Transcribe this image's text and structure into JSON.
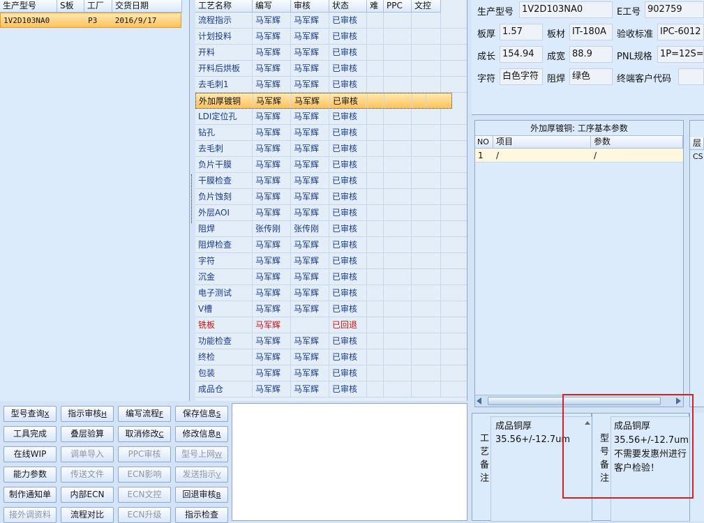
{
  "orders": {
    "headers": [
      "生产型号",
      "S板",
      "工厂",
      "交货日期"
    ],
    "rows": [
      {
        "model": "1V2D103NA0",
        "sboard": "",
        "factory": "P3",
        "date": "2016/9/17"
      }
    ]
  },
  "process": {
    "headers": [
      "工艺名称",
      "编写",
      "审核",
      "状态",
      "难",
      "PPC",
      "文控"
    ],
    "rows": [
      {
        "name": "流程指示",
        "writer": "马军辉",
        "reviewer": "马军辉",
        "status": "已审核"
      },
      {
        "name": "计划投料",
        "writer": "马军辉",
        "reviewer": "马军辉",
        "status": "已审核"
      },
      {
        "name": "开料",
        "writer": "马军辉",
        "reviewer": "马军辉",
        "status": "已审核"
      },
      {
        "name": "开料后烘板",
        "writer": "马军辉",
        "reviewer": "马军辉",
        "status": "已审核"
      },
      {
        "name": "去毛刺1",
        "writer": "马军辉",
        "reviewer": "马军辉",
        "status": "已审核"
      },
      {
        "name": "外加厚镀铜",
        "writer": "马军辉",
        "reviewer": "马军辉",
        "status": "已审核"
      },
      {
        "name": "LDI定位孔",
        "writer": "马军辉",
        "reviewer": "马军辉",
        "status": "已审核"
      },
      {
        "name": "钻孔",
        "writer": "马军辉",
        "reviewer": "马军辉",
        "status": "已审核"
      },
      {
        "name": "去毛刺",
        "writer": "马军辉",
        "reviewer": "马军辉",
        "status": "已审核"
      },
      {
        "name": "负片干膜",
        "writer": "马军辉",
        "reviewer": "马军辉",
        "status": "已审核"
      },
      {
        "name": "干膜检查",
        "writer": "马军辉",
        "reviewer": "马军辉",
        "status": "已审核"
      },
      {
        "name": "负片蚀刻",
        "writer": "马军辉",
        "reviewer": "马军辉",
        "status": "已审核"
      },
      {
        "name": "外层AOI",
        "writer": "马军辉",
        "reviewer": "马军辉",
        "status": "已审核"
      },
      {
        "name": "阻焊",
        "writer": "张传刚",
        "reviewer": "张传刚",
        "status": "已审核"
      },
      {
        "name": "阻焊检查",
        "writer": "马军辉",
        "reviewer": "马军辉",
        "status": "已审核"
      },
      {
        "name": "字符",
        "writer": "马军辉",
        "reviewer": "马军辉",
        "status": "已审核"
      },
      {
        "name": "沉金",
        "writer": "马军辉",
        "reviewer": "马军辉",
        "status": "已审核"
      },
      {
        "name": "电子测试",
        "writer": "马军辉",
        "reviewer": "马军辉",
        "status": "已审核"
      },
      {
        "name": "V槽",
        "writer": "马军辉",
        "reviewer": "马军辉",
        "status": "已审核"
      },
      {
        "name": "铣板",
        "writer": "马军辉",
        "reviewer": "",
        "status": "已回退"
      },
      {
        "name": "功能检查",
        "writer": "马军辉",
        "reviewer": "马军辉",
        "status": "已审核"
      },
      {
        "name": "终检",
        "writer": "马军辉",
        "reviewer": "马军辉",
        "status": "已审核"
      },
      {
        "name": "包装",
        "writer": "马军辉",
        "reviewer": "马军辉",
        "status": "已审核"
      },
      {
        "name": "成品仓",
        "writer": "马军辉",
        "reviewer": "马军辉",
        "status": "已审核"
      }
    ]
  },
  "info": {
    "model_label": "生产型号",
    "model_value": "1V2D103NA0",
    "eno_label": "E工号",
    "eno_value": "902759",
    "thickness_label": "板厚",
    "thickness_value": "1.57",
    "material_label": "板材",
    "material_value": "IT-180A",
    "standard_label": "验收标准",
    "standard_value": "IPC-6012",
    "length_label": "成长",
    "length_value": "154.94",
    "width_label": "成宽",
    "width_value": "88.9",
    "pnl_label": "PNL规格",
    "pnl_value": "1P=12S=",
    "char_label": "字符",
    "char_value": "白色字符",
    "mask_label": "阻焊",
    "mask_value": "绿色",
    "customer_label": "终端客户代码",
    "customer_value": ""
  },
  "param": {
    "title": "外加厚镀铜: 工序基本参数",
    "headers": [
      "NO",
      "项目",
      "参数"
    ],
    "rows": [
      {
        "no": "1",
        "item": "/",
        "value": "/"
      }
    ],
    "side_header": "层",
    "side_cell": "CS"
  },
  "notes": {
    "process_label": "工艺备注",
    "process_lines": [
      "成品铜厚",
      "35.56+/-12.7um"
    ],
    "model_label": "型号备注",
    "model_lines": [
      "成品铜厚",
      "35.56+/-12.7um",
      "不需要发惠州进行",
      "客户检验！"
    ]
  },
  "buttons": [
    {
      "label": "型号查询",
      "key": "X",
      "enabled": true
    },
    {
      "label": "指示审核",
      "key": "H",
      "enabled": true
    },
    {
      "label": "编写流程",
      "key": "F",
      "enabled": true
    },
    {
      "label": "保存信息",
      "key": "S",
      "enabled": true
    },
    {
      "label": "工具完成",
      "key": "",
      "enabled": true
    },
    {
      "label": "叠层验算",
      "key": "",
      "enabled": true
    },
    {
      "label": "取消修改",
      "key": "C",
      "enabled": true
    },
    {
      "label": "修改信息",
      "key": "R",
      "enabled": true
    },
    {
      "label": "在线WIP",
      "key": "",
      "enabled": true
    },
    {
      "label": "调单导入",
      "key": "",
      "enabled": false
    },
    {
      "label": "PPC审核",
      "key": "",
      "enabled": false
    },
    {
      "label": "型号上网",
      "key": "W",
      "enabled": false
    },
    {
      "label": "能力参数",
      "key": "",
      "enabled": true
    },
    {
      "label": "传送文件",
      "key": "",
      "enabled": false
    },
    {
      "label": "ECN影响",
      "key": "",
      "enabled": false
    },
    {
      "label": "发送指示",
      "key": "V",
      "enabled": false
    },
    {
      "label": "制作通知单",
      "key": "",
      "enabled": true
    },
    {
      "label": "内部ECN",
      "key": "",
      "enabled": true
    },
    {
      "label": "ECN文控",
      "key": "",
      "enabled": false
    },
    {
      "label": "回退审核",
      "key": "B",
      "enabled": true
    },
    {
      "label": "接外调资料",
      "key": "",
      "enabled": false
    },
    {
      "label": "流程对比",
      "key": "",
      "enabled": true
    },
    {
      "label": "ECN升级",
      "key": "",
      "enabled": false
    },
    {
      "label": "指示检查",
      "key": "",
      "enabled": true
    }
  ],
  "colors": {
    "selection": "#ffc25c",
    "highlight_box": "#d42020",
    "link_text": "#1a3a8c",
    "rejected_text": "#d01010"
  }
}
